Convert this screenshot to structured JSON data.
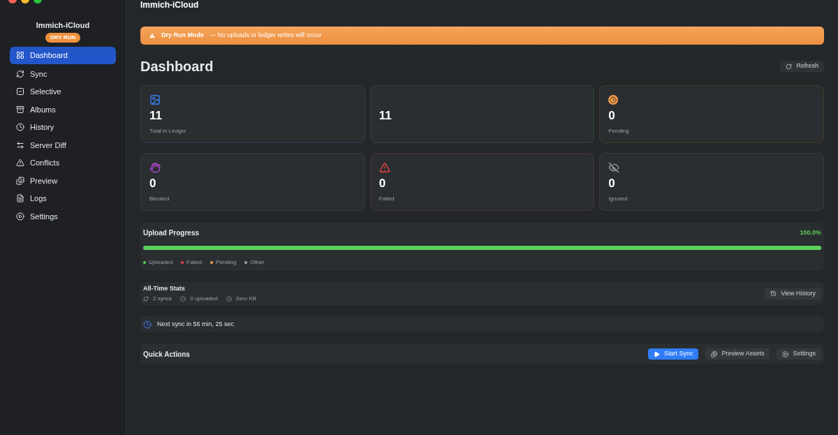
{
  "window": {
    "title": "Immich-iCloud"
  },
  "sidebar": {
    "app_name": "Immich-iCloud",
    "badge": "DRY RUN",
    "items": [
      {
        "label": "Dashboard",
        "selected": true
      },
      {
        "label": "Sync",
        "selected": false
      },
      {
        "label": "Selective",
        "selected": false
      },
      {
        "label": "Albums",
        "selected": false
      },
      {
        "label": "History",
        "selected": false
      },
      {
        "label": "Server Diff",
        "selected": false
      },
      {
        "label": "Conflicts",
        "selected": false
      },
      {
        "label": "Preview",
        "selected": false
      },
      {
        "label": "Logs",
        "selected": false
      },
      {
        "label": "Settings",
        "selected": false
      }
    ]
  },
  "banner": {
    "title": "Dry Run Mode",
    "message": "— No uploads or ledger writes will occur"
  },
  "page_title": "Dashboard",
  "refresh_button": "Refresh",
  "stats": [
    {
      "value": "11",
      "label": "Total in Ledger",
      "color": "#2f3d52",
      "kind": "photo"
    },
    {
      "value": "11",
      "color": "#32443a",
      "kind": "hidden"
    },
    {
      "value": "0",
      "label": "Pending",
      "color": "#48392c",
      "kind": "clock"
    },
    {
      "value": "0",
      "label": "Blocked",
      "color": "#3e3349",
      "kind": "hand"
    },
    {
      "value": "0",
      "label": "Failed",
      "color": "#4a3131",
      "kind": "alert"
    },
    {
      "value": "0",
      "label": "Ignored",
      "color": "#3a3d40",
      "kind": "eye-off"
    }
  ],
  "upload_progress": {
    "title": "Upload Progress",
    "reading": "100.0%",
    "level": 1.0,
    "legend": [
      {
        "label": "Uploaded",
        "color": "#5ccf5c"
      },
      {
        "label": "Failed",
        "color": "#ef4444"
      },
      {
        "label": "Pending",
        "color": "#f59e4b"
      },
      {
        "label": "Other",
        "color": "#9ca3af"
      }
    ]
  },
  "all_time_stats": {
    "title": "All-Time Stats",
    "items": [
      "2 syncs",
      "0 uploaded",
      "Zero KB"
    ],
    "button": "View History"
  },
  "next_sync": "Next sync in 56 min, 25 sec",
  "quick_actions": {
    "title": "Quick Actions",
    "buttons": [
      {
        "label": "Start Sync",
        "kind": "primary"
      },
      {
        "label": "Preview Assets",
        "kind": "secondary"
      },
      {
        "label": "Settings",
        "kind": "secondary"
      }
    ]
  }
}
